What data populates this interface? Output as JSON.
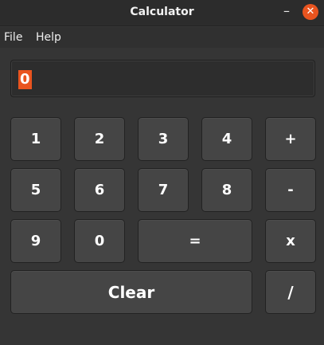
{
  "window": {
    "title": "Calculator"
  },
  "titlebar": {
    "minimize_glyph": "–",
    "close_glyph": "✕"
  },
  "menu": {
    "file": "File",
    "help": "Help"
  },
  "display": {
    "value": "0"
  },
  "keys": {
    "k1": "1",
    "k2": "2",
    "k3": "3",
    "k4": "4",
    "plus": "+",
    "k5": "5",
    "k6": "6",
    "k7": "7",
    "k8": "8",
    "minus": "-",
    "k9": "9",
    "k0": "0",
    "equals": "=",
    "multiply": "x",
    "clear": "Clear",
    "divide": "/"
  },
  "colors": {
    "accent": "#e9541f",
    "background": "#353535",
    "key": "#454545"
  },
  "icons": {
    "minimize": "minimize-icon",
    "close": "close-icon"
  }
}
